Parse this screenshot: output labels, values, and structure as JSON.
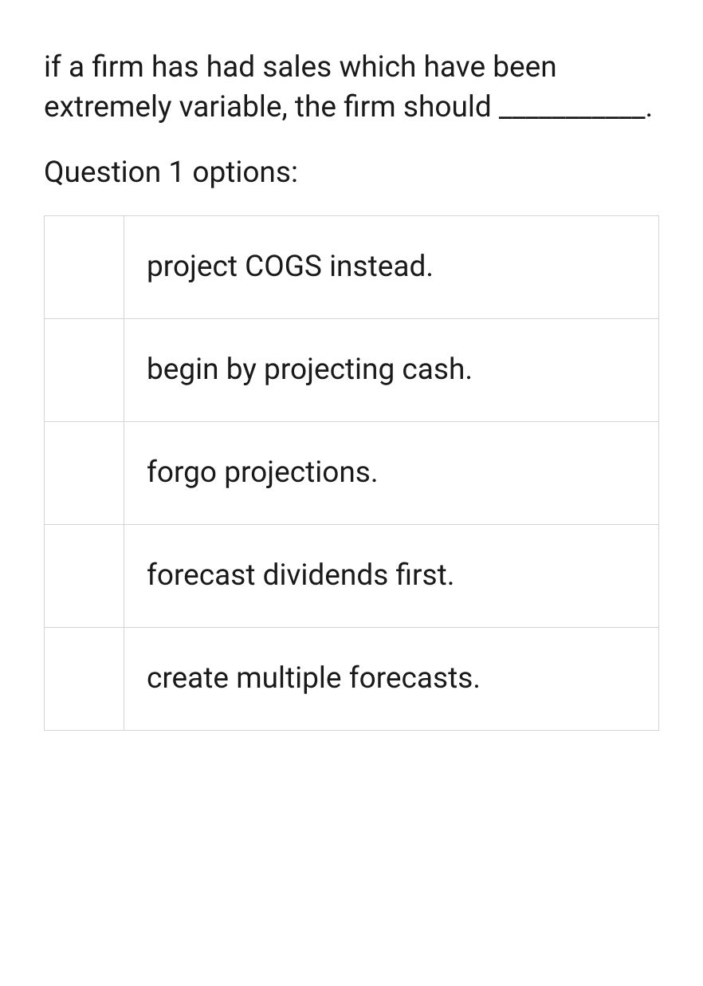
{
  "question": {
    "stem": "if a firm has had sales which have been extremely variable, the firm should ___________.",
    "options_label": "Question 1 options:",
    "options": [
      {
        "text": "project COGS instead."
      },
      {
        "text": "begin by projecting cash."
      },
      {
        "text": "forgo projections."
      },
      {
        "text": "forecast dividends first."
      },
      {
        "text": "create multiple forecasts."
      }
    ]
  }
}
